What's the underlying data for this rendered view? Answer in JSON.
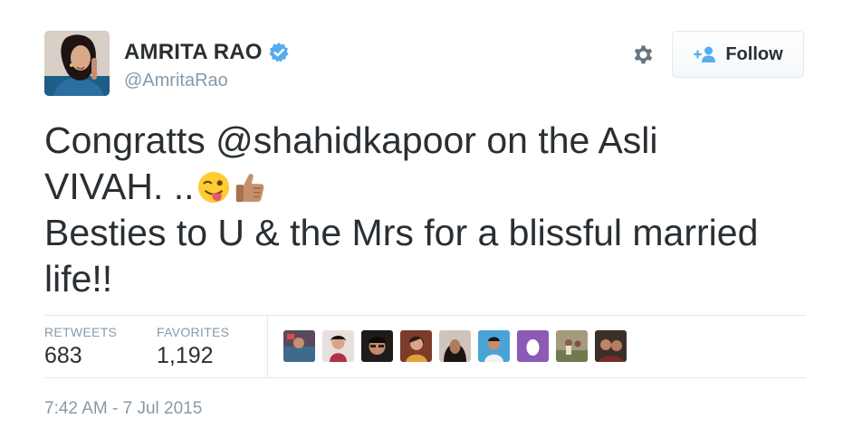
{
  "user": {
    "name": "AMRITA RAO",
    "handle": "@AmritaRao"
  },
  "follow_button": {
    "label": "Follow"
  },
  "tweet": {
    "line1": "Congratts @shahidkapoor on the Asli",
    "line2": "VIVAH. ..",
    "line3": "Besties to U & the Mrs for a blissful married",
    "line4": "life!!"
  },
  "stats": {
    "retweets_label": "RETWEETS",
    "retweets_value": "683",
    "favorites_label": "FAVORITES",
    "favorites_value": "1,192"
  },
  "timestamp": "7:42 AM - 7 Jul 2015",
  "icons": [
    "verified-badge-icon",
    "gear-icon",
    "follow-person-icon",
    "winking-tongue-emoji",
    "thumbs-up-emoji"
  ],
  "colors": {
    "verified": "#55acee",
    "follow_icon": "#55acee",
    "muted_text": "#8899a6",
    "main_text": "#292f33",
    "divider": "#e1e8ed"
  }
}
